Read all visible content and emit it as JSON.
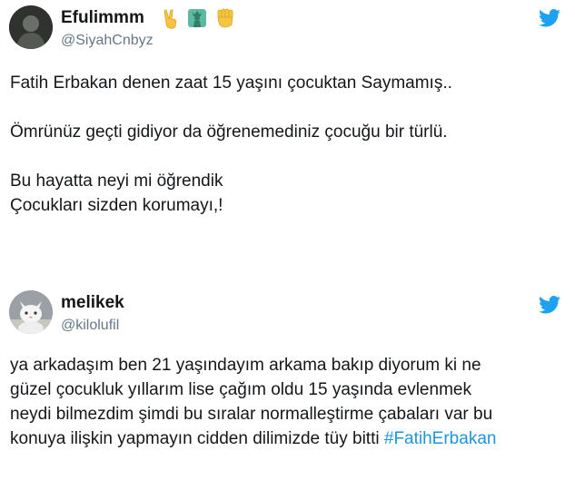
{
  "colors": {
    "text": "#14171a",
    "muted": "#657786",
    "accent": "#1da1f2",
    "link": "#1b95e0"
  },
  "tweets": [
    {
      "name": "Efulimmm",
      "handle": "@SiyahCnbyz",
      "name_emojis": [
        "victory-hand-icon",
        "statue-of-liberty-icon",
        "raised-fist-icon"
      ],
      "paragraphs": [
        "Fatih Erbakan denen zaat 15 yaşını çocuktan Saymamış..",
        "Ömrünüz geçti gidiyor da öğrenemediniz çocuğu bir türlü.",
        "Bu hayatta neyi mi öğrendik",
        "Çocukları sizden korumayı,!"
      ]
    },
    {
      "name": "melikek",
      "handle": "@kilolufil",
      "lines": [
        "ya arkadaşım ben 21 yaşındayım arkama bakıp diyorum ki ne",
        "güzel çocukluk yıllarım lise çağım oldu 15 yaşında evlenmek",
        "neydi bilmezdim şimdi bu sıralar normalleştirme çabaları var bu",
        "konuya ilişkin yapmayın cidden dilimizde tüy bitti"
      ],
      "hashtag": "#FatihErbakan"
    }
  ]
}
